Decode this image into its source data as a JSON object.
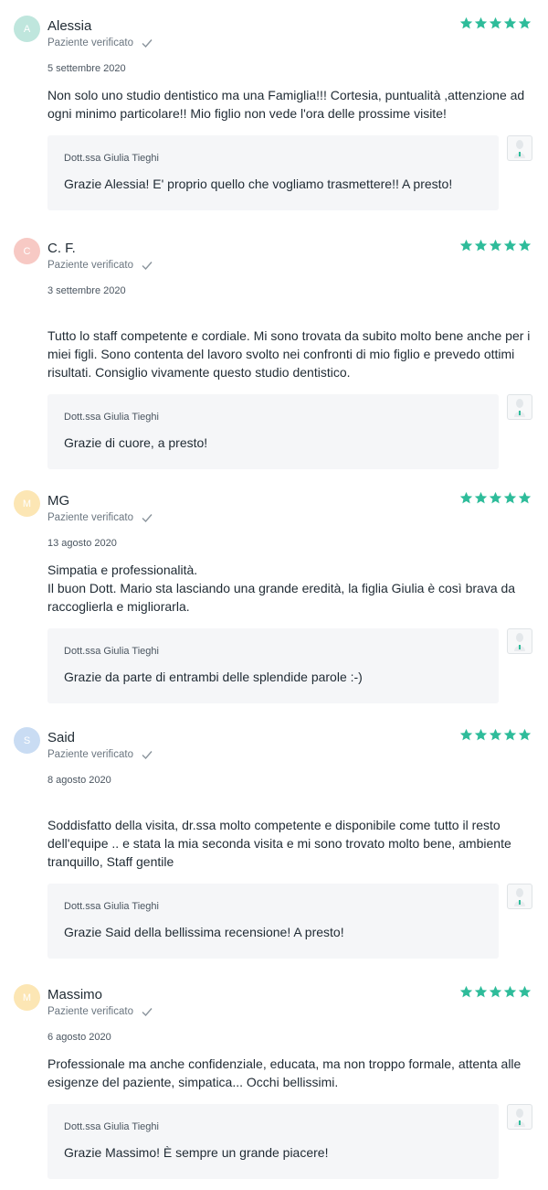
{
  "colors": {
    "star": "#2ebc9a",
    "reply_bg": "#f5f6f8",
    "avatar_a": "#bfe6dd",
    "avatar_c": "#f7c9c4",
    "avatar_m": "#fce6b4",
    "avatar_s": "#c9dcf3"
  },
  "reviews": [
    {
      "initial": "A",
      "name": "Alessia",
      "verified": "Paziente verificato",
      "date": "5 settembre 2020",
      "rating": 5,
      "text": "Non solo uno studio dentistico ma una Famiglia!!! Cortesia, puntualità ,attenzione ad ogni minimo particolare!! Mio figlio non vede l'ora delle prossime visite!",
      "reply_author": "Dott.ssa Giulia Tieghi",
      "reply_text": "Grazie Alessia! E' proprio quello che vogliamo trasmettere!! A presto!"
    },
    {
      "initial": "C",
      "name": "C. F.",
      "verified": "Paziente verificato",
      "date": "3 settembre 2020",
      "rating": 5,
      "text": "Tutto lo staff competente e cordiale. Mi sono trovata da subito molto bene anche per i miei figli. Sono contenta del lavoro svolto nei confronti di mio figlio e prevedo ottimi risultati. Consiglio vivamente questo studio dentistico.",
      "reply_author": "Dott.ssa Giulia Tieghi",
      "reply_text": "Grazie di cuore, a presto!"
    },
    {
      "initial": "M",
      "name": "MG",
      "verified": "Paziente verificato",
      "date": "13 agosto 2020",
      "rating": 5,
      "text": "Simpatia e professionalità.\nIl buon Dott. Mario sta lasciando una grande eredità, la figlia Giulia è così brava da raccoglierla e migliorarla.",
      "reply_author": "Dott.ssa Giulia Tieghi",
      "reply_text": "Grazie da parte di entrambi delle splendide parole :-)"
    },
    {
      "initial": "S",
      "name": "Said",
      "verified": "Paziente verificato",
      "date": "8 agosto 2020",
      "rating": 5,
      "text": "Soddisfatto della visita, dr.ssa molto competente e disponibile come tutto il resto dell'equipe .. e stata la mia seconda visita e mi sono trovato molto bene, ambiente tranquillo, Staff gentile",
      "reply_author": "Dott.ssa Giulia Tieghi",
      "reply_text": "Grazie Said della bellissima recensione! A presto!"
    },
    {
      "initial": "M",
      "name": "Massimo",
      "verified": "Paziente verificato",
      "date": "6 agosto 2020",
      "rating": 5,
      "text": "Professionale ma anche confidenziale, educata, ma non troppo formale, attenta alle esigenze del paziente, simpatica... Occhi bellissimi.",
      "reply_author": "Dott.ssa Giulia Tieghi",
      "reply_text": "Grazie Massimo! È sempre un grande piacere!"
    }
  ]
}
